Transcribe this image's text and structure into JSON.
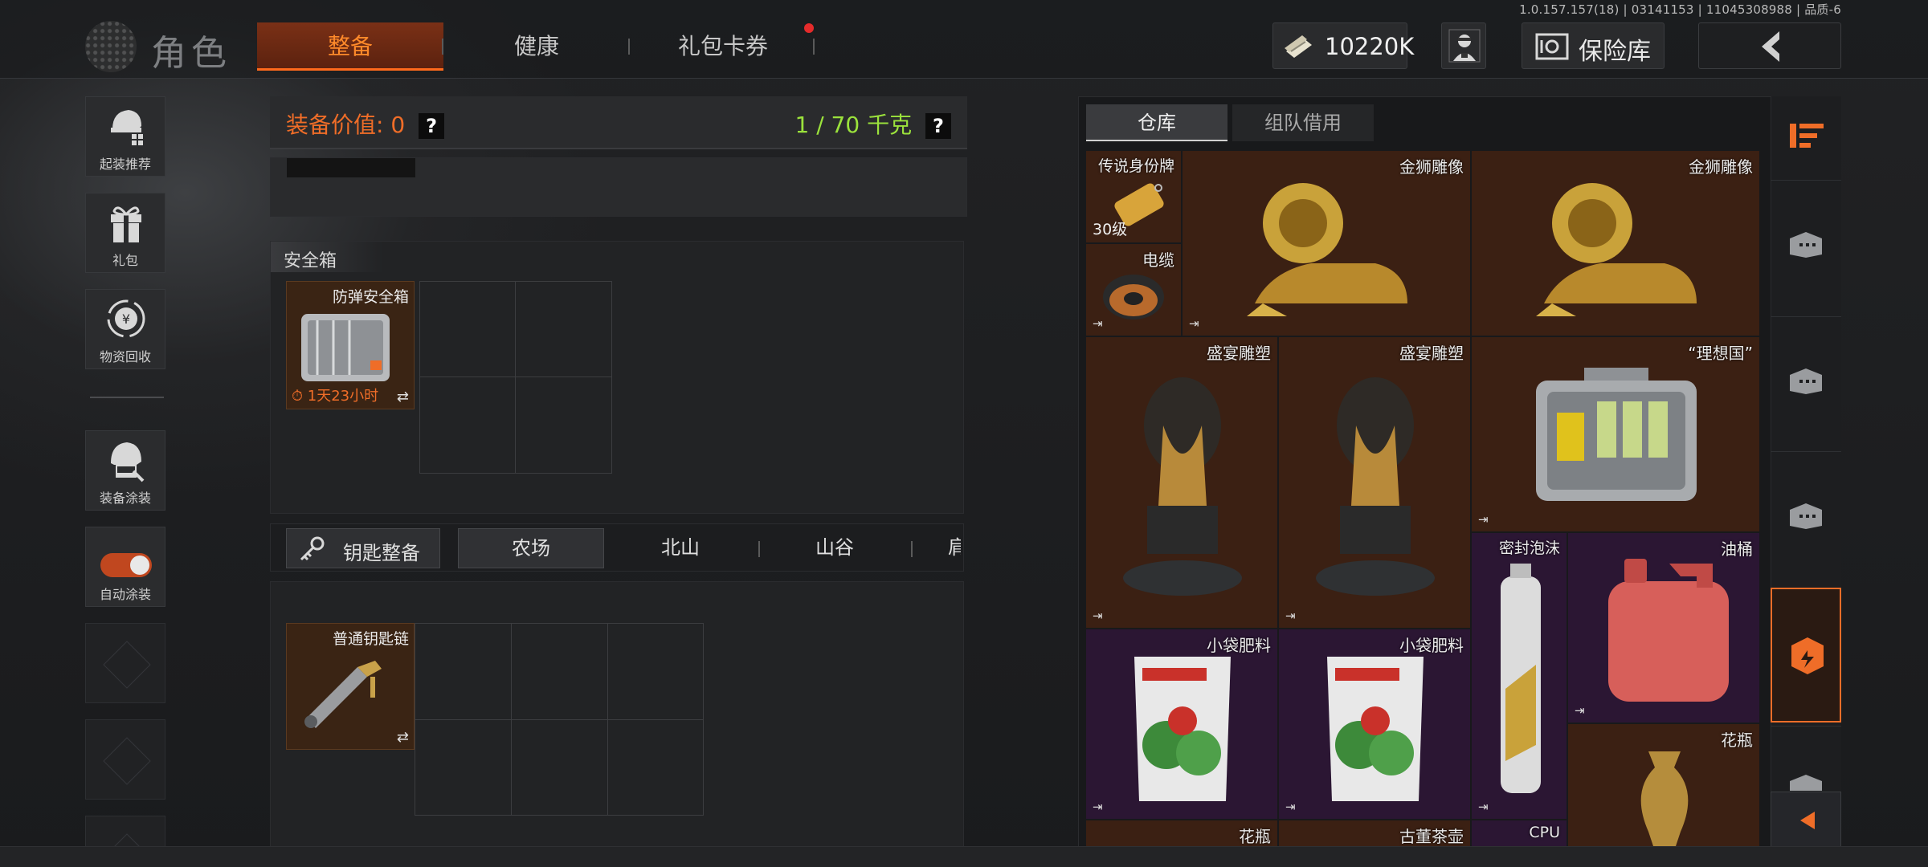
{
  "version": "1.0.157.157(18) | 03141153 | 11045308988 | 品质-6",
  "header": {
    "title": "角色",
    "tabs": [
      {
        "label": "整备",
        "active": true
      },
      {
        "label": "健康",
        "active": false
      },
      {
        "label": "礼包卡券",
        "active": false
      }
    ],
    "currency": "10220K",
    "safe_label": "保险库"
  },
  "sidebar": {
    "items": [
      {
        "label": "起装推荐",
        "icon": "helmet-gear-icon"
      },
      {
        "label": "礼包",
        "icon": "gift-icon"
      },
      {
        "label": "物资回收",
        "icon": "recycle-icon"
      },
      {
        "label": "装备涂装",
        "icon": "paint-helmet-icon"
      },
      {
        "label": "自动涂装",
        "icon": "toggle-icon"
      }
    ]
  },
  "equipment": {
    "value_label": "装备价值: 0",
    "weight_label": "1 / 70 千克",
    "help": "?"
  },
  "secure_box": {
    "section_title": "安全箱",
    "item_name": "防弹安全箱",
    "timer": "1天23小时",
    "swap": "⇄"
  },
  "keys": {
    "button_label": "钥匙整备",
    "map_tabs": [
      "农场",
      "北山",
      "山谷",
      "肩"
    ],
    "item_name": "普通钥匙链",
    "swap": "⇄"
  },
  "storage": {
    "tabs": [
      {
        "label": "仓库",
        "active": true
      },
      {
        "label": "组队借用",
        "active": false
      }
    ],
    "items": [
      {
        "name": "传说身份牌",
        "sub": "30级",
        "bg": "orange"
      },
      {
        "name": "电缆",
        "bg": "orange"
      },
      {
        "name": "金狮雕像",
        "bg": "orange"
      },
      {
        "name": "金狮雕像",
        "bg": "orange"
      },
      {
        "name": "盛宴雕塑",
        "bg": "orange"
      },
      {
        "name": "盛宴雕塑",
        "bg": "orange"
      },
      {
        "name": "“理想国”",
        "bg": "orange"
      },
      {
        "name": "小袋肥料",
        "bg": "purple"
      },
      {
        "name": "小袋肥料",
        "bg": "purple"
      },
      {
        "name": "密封泡沫",
        "bg": "purple"
      },
      {
        "name": "油桶",
        "bg": "purple"
      },
      {
        "name": "花瓶",
        "bg": "orange"
      },
      {
        "name": "花瓶",
        "bg": "orange"
      },
      {
        "name": "古董茶壶",
        "bg": "orange"
      },
      {
        "name": "CPU",
        "bg": "purple"
      }
    ],
    "export_glyph": "⇥"
  },
  "colors": {
    "accent_orange": "#ef6d28",
    "weight_green": "#9be23c",
    "legendary_bg": "#3b2013",
    "epic_bg": "#2b1633"
  }
}
